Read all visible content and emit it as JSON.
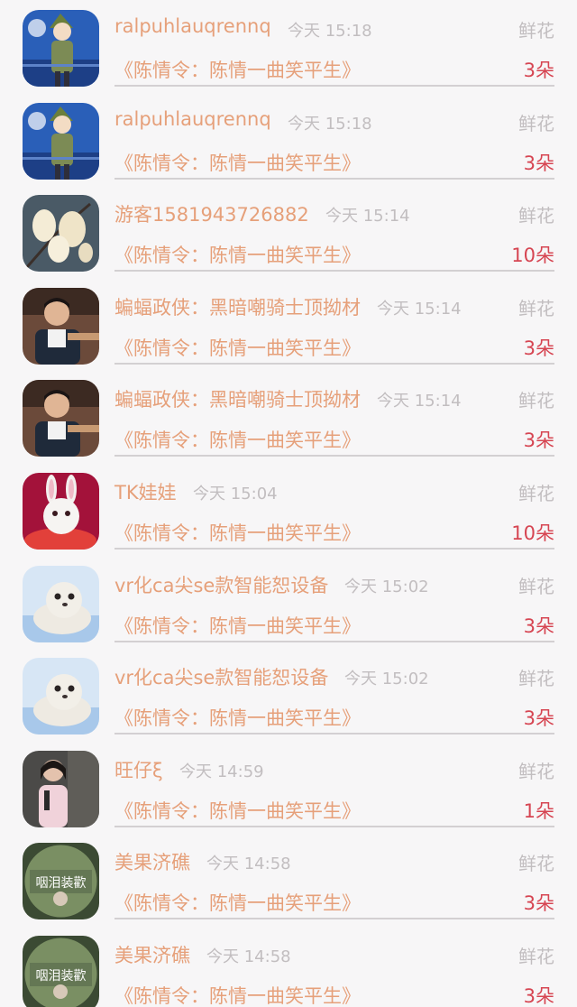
{
  "list": {
    "items": [
      {
        "name": "ralpuhlauqrennq",
        "time": "今天 15:18",
        "gift": "鲜花",
        "book": "《陈情令：陈情一曲笑平生》",
        "qty": "3朵",
        "avatar_icon": "avatar-anime-boy"
      },
      {
        "name": "ralpuhlauqrennq",
        "time": "今天 15:18",
        "gift": "鲜花",
        "book": "《陈情令：陈情一曲笑平生》",
        "qty": "3朵",
        "avatar_icon": "avatar-anime-boy"
      },
      {
        "name": "游客1581943726882",
        "time": "今天 15:14",
        "gift": "鲜花",
        "book": "《陈情令：陈情一曲笑平生》",
        "qty": "10朵",
        "avatar_icon": "avatar-magnolia"
      },
      {
        "name": "蝙蝠政侠：黑暗嘲骑士顶拗材",
        "time": "今天 15:14",
        "gift": "鲜花",
        "book": "《陈情令：陈情一曲笑平生》",
        "qty": "3朵",
        "avatar_icon": "avatar-man-photo"
      },
      {
        "name": "蝙蝠政侠：黑暗嘲骑士顶拗材",
        "time": "今天 15:14",
        "gift": "鲜花",
        "book": "《陈情令：陈情一曲笑平生》",
        "qty": "3朵",
        "avatar_icon": "avatar-man-photo"
      },
      {
        "name": "TK娃娃",
        "time": "今天 15:04",
        "gift": "鲜花",
        "book": "《陈情令：陈情一曲笑平生》",
        "qty": "10朵",
        "avatar_icon": "avatar-rabbit"
      },
      {
        "name": "vr化ca尖se款智能恕设备",
        "time": "今天 15:02",
        "gift": "鲜花",
        "book": "《陈情令：陈情一曲笑平生》",
        "qty": "3朵",
        "avatar_icon": "avatar-seal"
      },
      {
        "name": "vr化ca尖se款智能恕设备",
        "time": "今天 15:02",
        "gift": "鲜花",
        "book": "《陈情令：陈情一曲笑平生》",
        "qty": "3朵",
        "avatar_icon": "avatar-seal"
      },
      {
        "name": "旺仔ξ",
        "time": "今天 14:59",
        "gift": "鲜花",
        "book": "《陈情令：陈情一曲笑平生》",
        "qty": "1朵",
        "avatar_icon": "avatar-girl-photo"
      },
      {
        "name": "美果济礁",
        "time": "今天 14:58",
        "gift": "鲜花",
        "book": "《陈情令：陈情一曲笑平生》",
        "qty": "3朵",
        "avatar_icon": "avatar-round-badge",
        "avatar_text": "咽泪装歡"
      },
      {
        "name": "美果济礁",
        "time": "今天 14:58",
        "gift": "鲜花",
        "book": "《陈情令：陈情一曲笑平生》",
        "qty": "3朵",
        "avatar_icon": "avatar-round-badge",
        "avatar_text": "咽泪装歡"
      }
    ]
  }
}
